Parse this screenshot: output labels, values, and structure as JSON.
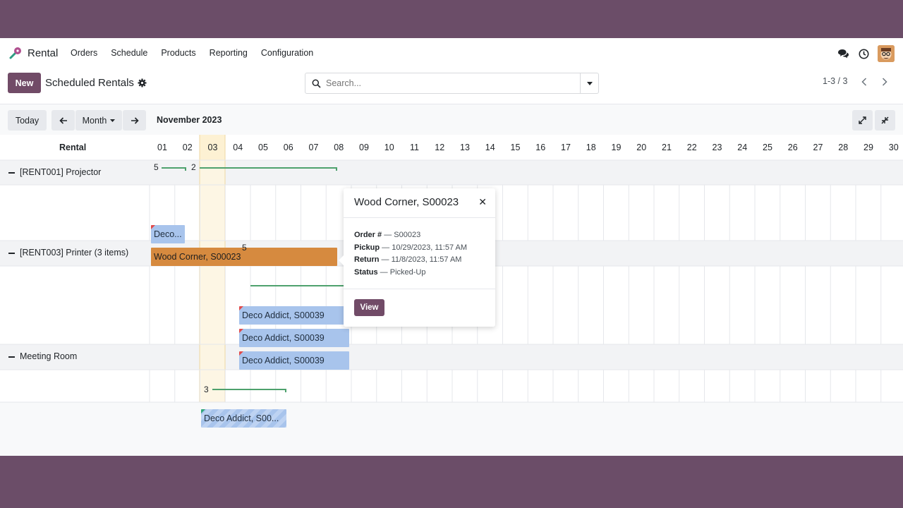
{
  "navbar": {
    "app_name": "Rental",
    "menu": [
      "Orders",
      "Schedule",
      "Products",
      "Reporting",
      "Configuration"
    ]
  },
  "control_panel": {
    "new_label": "New",
    "title": "Scheduled Rentals",
    "search_placeholder": "Search...",
    "pager": "1-3 / 3"
  },
  "gantt_toolbar": {
    "today_label": "Today",
    "scale_label": "Month",
    "period": "November 2023"
  },
  "gantt": {
    "header_label": "Rental",
    "days": [
      "01",
      "02",
      "03",
      "04",
      "05",
      "06",
      "07",
      "08",
      "09",
      "10",
      "11",
      "12",
      "13",
      "14",
      "15",
      "16",
      "17",
      "18",
      "19",
      "20",
      "21",
      "22",
      "23",
      "24",
      "25",
      "26",
      "27",
      "28",
      "29",
      "30"
    ],
    "groups": [
      {
        "label": "[RENT001] Projector",
        "counts": [
          "5",
          "2"
        ],
        "pills": [
          "Deco...",
          "Wood Corner, S00023"
        ]
      },
      {
        "label": "[RENT003] Printer (3 items)",
        "counts": [
          "5"
        ],
        "pills": [
          "Deco Addict, S00039",
          "Deco Addict, S00039",
          "Deco Addict, S00039"
        ]
      },
      {
        "label": "Meeting Room",
        "counts": [
          "3"
        ],
        "pills": [
          "Deco Addict, S00..."
        ]
      }
    ]
  },
  "popover": {
    "title": "Wood Corner, S00023",
    "fields": [
      {
        "label": "Order #",
        "value": "S00023"
      },
      {
        "label": "Pickup",
        "value": "10/29/2023, 11:57 AM"
      },
      {
        "label": "Return",
        "value": "11/8/2023, 11:57 AM"
      },
      {
        "label": "Status",
        "value": "Picked-Up"
      }
    ],
    "view_label": "View"
  },
  "colors": {
    "brand": "#714b67",
    "pill_blue": "#a8c4ec",
    "pill_orange": "#d68a3f",
    "today_column": "#fdf5e1"
  }
}
